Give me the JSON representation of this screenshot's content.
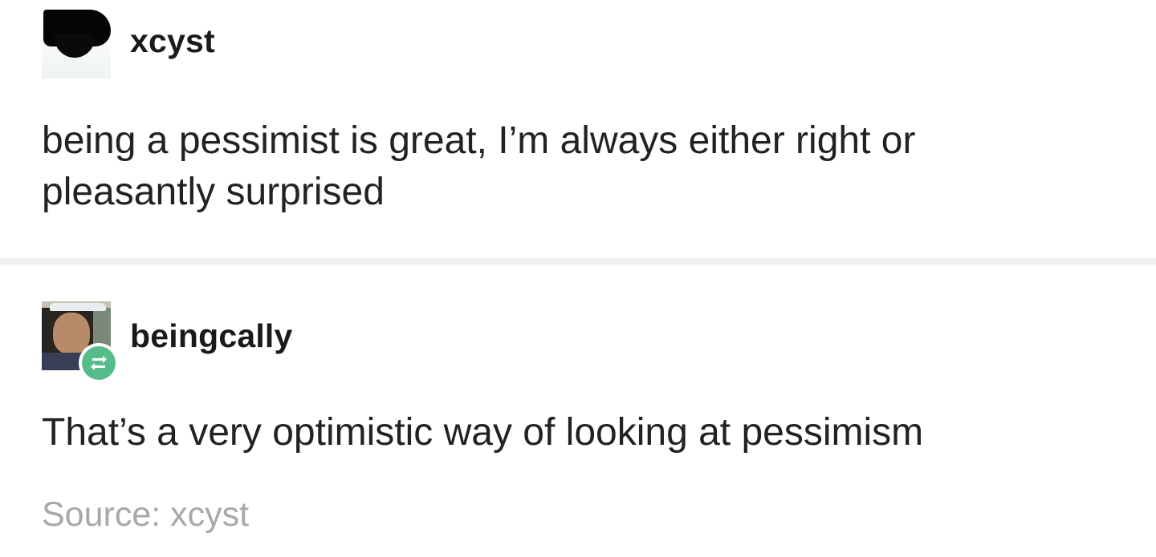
{
  "original_post": {
    "username": "xcyst",
    "text_line1": "being a pessimist is great, I’m always either right or",
    "text_line2": "pleasantly surprised"
  },
  "reblog": {
    "username": "beingcally",
    "text": "That’s a very optimistic way of looking at pessimism",
    "badge_icon": "reblog-icon",
    "badge_color": "#56bc8a"
  },
  "footer": {
    "source_label": "Source:",
    "source_value": "xcyst"
  }
}
